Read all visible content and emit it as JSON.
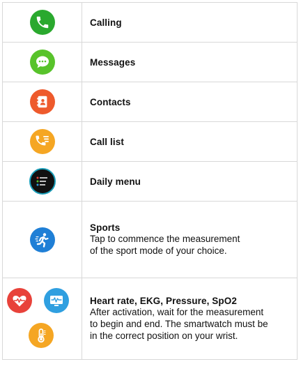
{
  "rows": [
    {
      "title": "Calling",
      "icon": "phone-icon",
      "color": "#2aa92e"
    },
    {
      "title": "Messages",
      "icon": "chat-bubble-icon",
      "color": "#58c32b"
    },
    {
      "title": "Contacts",
      "icon": "contacts-book-icon",
      "color": "#ee5a2c"
    },
    {
      "title": "Call list",
      "icon": "call-list-icon",
      "color": "#f5a623"
    },
    {
      "title": "Daily menu",
      "icon": "daily-menu-watchface-icon",
      "color": "#111111"
    },
    {
      "title": "Sports",
      "description_lines": [
        "Tap to commence the measurement",
        "of the sport mode of your choice."
      ],
      "icon": "running-man-icon",
      "color": "#1f7fd6"
    },
    {
      "title": "Heart rate, EKG, Pressure, SpO2",
      "description_lines": [
        "After activation, wait for the measurement",
        "to begin and end. The smartwatch must be",
        "in the correct position on your wrist."
      ],
      "icons": [
        "heart-rate-icon",
        "ekg-icon",
        "thermometer-icon"
      ],
      "colors": [
        "#e8423a",
        "#2f9fe0",
        "#f5a623"
      ]
    }
  ]
}
